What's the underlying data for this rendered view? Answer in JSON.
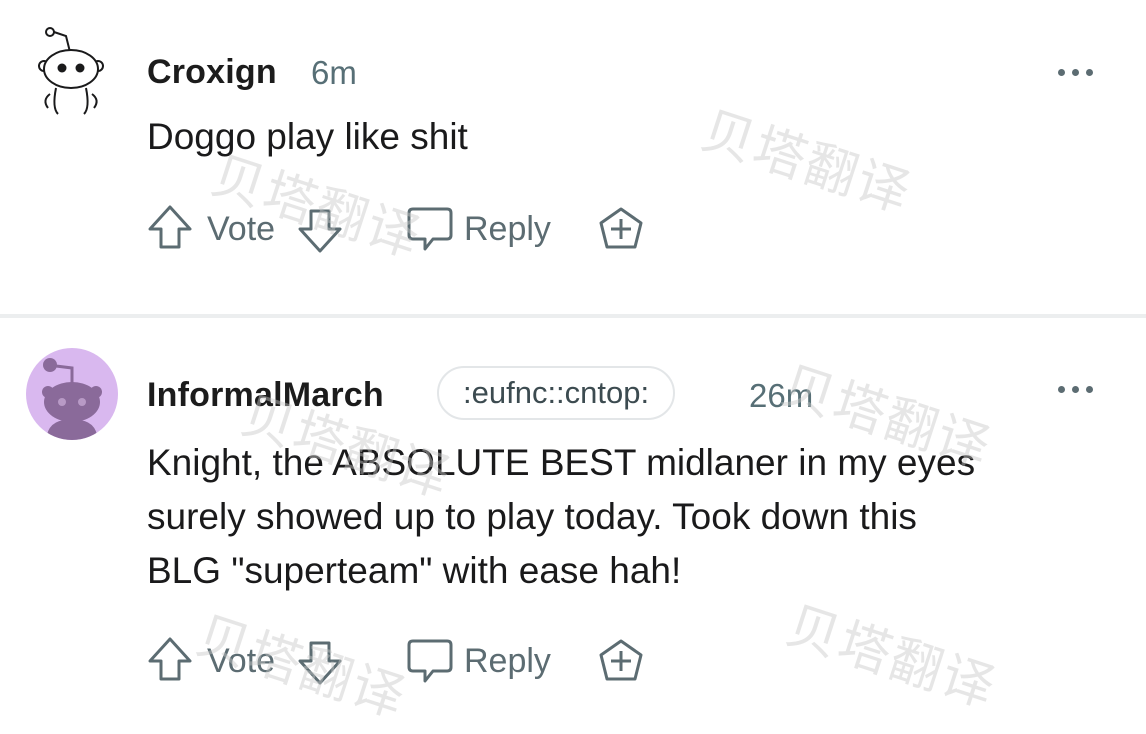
{
  "comments": [
    {
      "username": "Croxign",
      "time": "6m",
      "flair": "",
      "body_lines": [
        "Doggo play like shit"
      ],
      "vote_label": "Vote",
      "reply_label": "Reply",
      "avatar_icon": "snoo-default-avatar-icon"
    },
    {
      "username": "InformalMarch",
      "time": "26m",
      "flair": ":eufnc::cntop:",
      "body_lines": [
        "Knight, the ABSOLUTE BEST midlaner in my eyes",
        "surely showed up to play today. Took down this",
        "BLG \"superteam\" with ease hah!"
      ],
      "vote_label": "Vote",
      "reply_label": "Reply",
      "avatar_icon": "snoo-purple-avatar-icon"
    }
  ],
  "icons": {
    "upvote": "arrow-up-icon",
    "downvote": "arrow-down-icon",
    "reply": "speech-bubble-icon",
    "award": "add-award-icon",
    "more": "more-options-icon"
  },
  "colors": {
    "text_primary": "#1a1a1b",
    "text_secondary": "#576f76",
    "icon_gray": "#5c6c72",
    "avatar_purple": "#d9b8ef",
    "divider": "#eceeef"
  },
  "watermark_text": "贝塔翻译"
}
